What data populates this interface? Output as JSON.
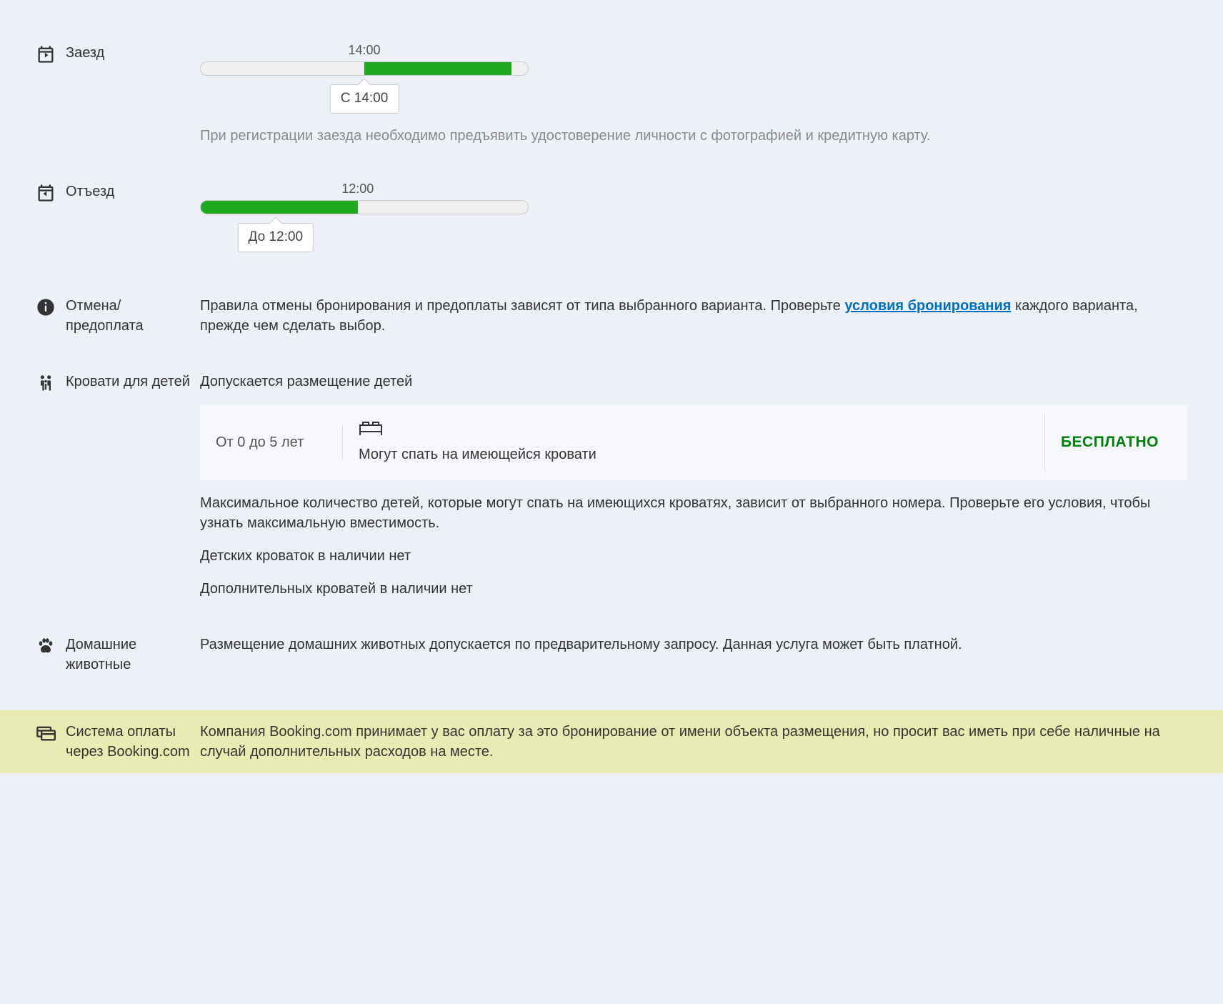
{
  "checkin": {
    "label": "Заезд",
    "tick_time": "14:00",
    "tooltip": "С 14:00",
    "bar_start_pct": 50,
    "bar_end_pct": 95,
    "tick_pos_pct": 50,
    "tooltip_pos_pct": 50,
    "note": "При регистрации заезда необходимо предъявить удостоверение личности с фотографией и кредитную карту."
  },
  "checkout": {
    "label": "Отъезд",
    "tick_time": "12:00",
    "tooltip": "До 12:00",
    "bar_start_pct": 0,
    "bar_end_pct": 48,
    "tick_pos_pct": 48,
    "tooltip_pos_pct": 23
  },
  "cancellation": {
    "label": "Отмена/ предоплата",
    "text_before": "Правила отмены бронирования и предоплаты зависят от типа выбранного варианта. Проверьте ",
    "link_text": "условия бронирования",
    "text_after": " каждого варианта, прежде чем сделать выбор."
  },
  "children": {
    "label": "Кровати для детей",
    "intro": "Допускается размещение детей",
    "age_range": "От 0 до 5 лет",
    "bed_text": "Могут спать на имеющейся кровати",
    "price": "БЕСПЛАТНО",
    "para1": "Максимальное количество детей, которые могут спать на имеющихся кроватях, зависит от выбранного номера. Проверьте его условия, чтобы узнать максимальную вместимость.",
    "para2": "Детских кроваток в наличии нет",
    "para3": "Дополнительных кроватей в наличии нет"
  },
  "pets": {
    "label": "Домашние животные",
    "text": "Размещение домашних животных допускается по предварительному запросу. Данная услуга может быть платной."
  },
  "payment": {
    "label": "Система оплаты через Booking.com",
    "text": "Компания Booking.com принимает у вас оплату за это бронирование от имени объекта размещения, но просит вас иметь при себе наличные на случай дополнительных расходов на месте."
  }
}
